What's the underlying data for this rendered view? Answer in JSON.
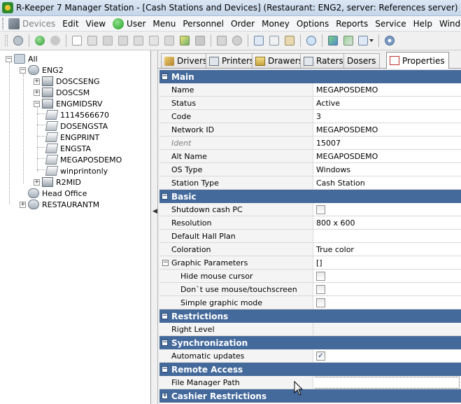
{
  "window": {
    "title": "R-Keeper 7 Manager Station - [Cash Stations and Devices] (Restaurant: ENG2, server: References server) - [Cash Stations"
  },
  "menu": [
    {
      "label": "Devices",
      "disabled": true
    },
    {
      "label": "Edit"
    },
    {
      "label": "View"
    },
    {
      "label": "User"
    },
    {
      "label": "Menu"
    },
    {
      "label": "Personnel"
    },
    {
      "label": "Order"
    },
    {
      "label": "Money"
    },
    {
      "label": "Options"
    },
    {
      "label": "Reports"
    },
    {
      "label": "Service"
    },
    {
      "label": "Help"
    },
    {
      "label": "Window"
    }
  ],
  "toolbar_icons": [
    "refresh-icon",
    "back-icon",
    "forward-icon",
    "new-icon",
    "copy-icon",
    "cut-icon",
    "print-icon",
    "print-preview-icon",
    "properties-icon",
    "folder-icon",
    "move-icon",
    "delete-icon",
    "save-icon",
    "cancel-icon",
    "copy2-icon",
    "cut2-icon",
    "paste-icon",
    "find-icon",
    "transfer-icon",
    "export-icon",
    "grid-icon",
    "settings-icon"
  ],
  "tree": {
    "root": "All",
    "restaurant": "ENG2",
    "servers": [
      "DOSCSENG",
      "DOSCSM",
      "ENGMIDSRV"
    ],
    "stations": [
      "1114566670",
      "DOSENGSTA",
      "ENGPRINT",
      "ENGSTA",
      "MEGAPOSDEMO",
      "winprintonly"
    ],
    "r2mid": "R2MID",
    "head_office": "Head Office",
    "restaurantm": "RESTAURANTM"
  },
  "tabs": [
    {
      "label": "Drivers"
    },
    {
      "label": "Printers"
    },
    {
      "label": "Drawers"
    },
    {
      "label": "Raters"
    },
    {
      "label": "Dosers"
    },
    {
      "label": "Properties"
    }
  ],
  "props": {
    "main": {
      "title": "Main",
      "rows": [
        {
          "name": "Name",
          "value": "MEGAPOSDEMO"
        },
        {
          "name": "Status",
          "value": "Active"
        },
        {
          "name": "Code",
          "value": "3"
        },
        {
          "name": "Network ID",
          "value": "MEGAPOSDEMO"
        },
        {
          "name": "Ident",
          "value": "15007"
        },
        {
          "name": "Alt Name",
          "value": "MEGAPOSDEMO"
        },
        {
          "name": "OS Type",
          "value": "Windows"
        },
        {
          "name": "Station Type",
          "value": "Cash Station"
        }
      ]
    },
    "basic": {
      "title": "Basic",
      "shutdown": "Shutdown cash PC",
      "resolution": {
        "name": "Resolution",
        "value": "800 x 600"
      },
      "hallplan": "Default Hall Plan",
      "coloration": {
        "name": "Coloration",
        "value": "True color"
      },
      "graphic": {
        "name": "Graphic Parameters",
        "value": "[]"
      },
      "hide_cursor": "Hide mouse cursor",
      "no_mouse": "Don`t use mouse/touchscreen",
      "simple_mode": "Simple graphic mode"
    },
    "restrictions": {
      "title": "Restrictions",
      "right_level": "Right Level"
    },
    "sync": {
      "title": "Synchronization",
      "auto_updates": "Automatic updates"
    },
    "remote": {
      "title": "Remote Access",
      "file_manager_path": "File Manager Path"
    },
    "cashier": {
      "title": "Cashier Restrictions"
    }
  }
}
